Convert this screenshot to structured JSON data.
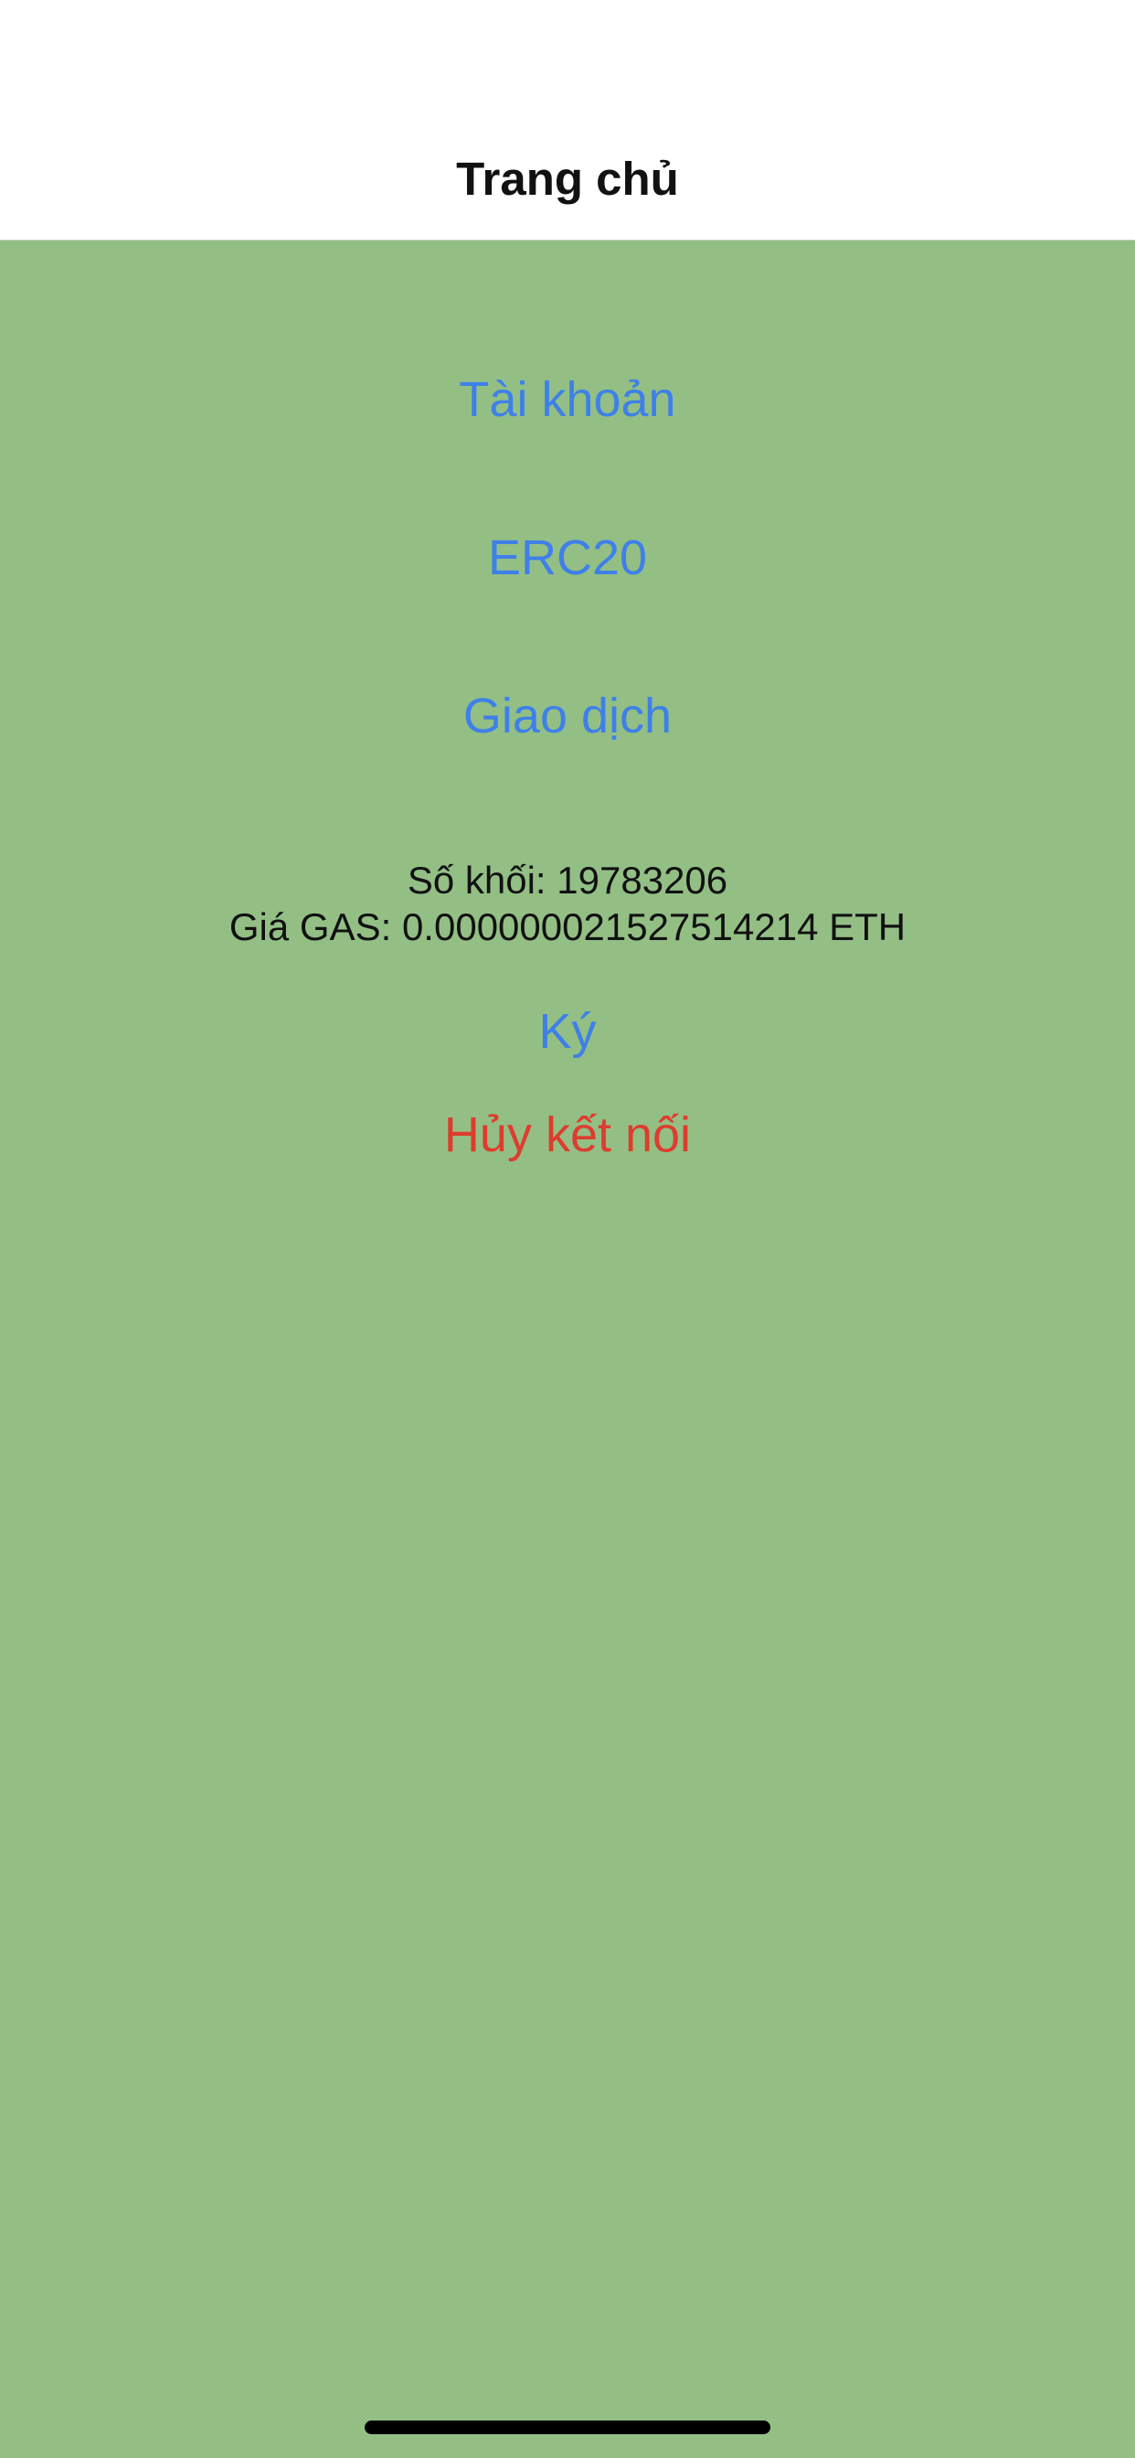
{
  "nav": {
    "title": "Trang chủ"
  },
  "menu": {
    "account": "Tài khoản",
    "erc20": "ERC20",
    "transaction": "Giao dịch"
  },
  "info": {
    "block_number": "Số khối: 19783206",
    "gas_price": "Giá GAS: 0.000000021527514214 ETH"
  },
  "actions": {
    "sign": "Ký",
    "disconnect": "Hủy kết nối"
  },
  "colors": {
    "background": "#93bf85",
    "link": "#3f80e8",
    "danger": "#dd3d2e"
  }
}
